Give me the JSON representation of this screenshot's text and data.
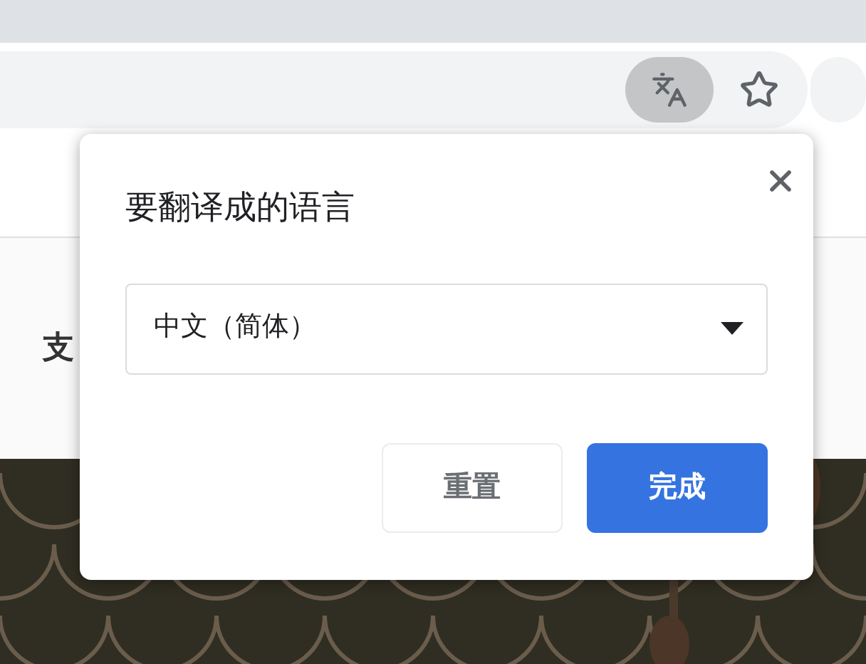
{
  "toolbar": {
    "translate_button": {
      "selected": true
    }
  },
  "page": {
    "side_text": "支"
  },
  "dialog": {
    "title": "要翻译成的语言",
    "language_select": {
      "value": "中文（简体）"
    },
    "buttons": [
      {
        "label": "重置",
        "kind": "secondary"
      },
      {
        "label": "完成",
        "kind": "primary"
      }
    ]
  }
}
